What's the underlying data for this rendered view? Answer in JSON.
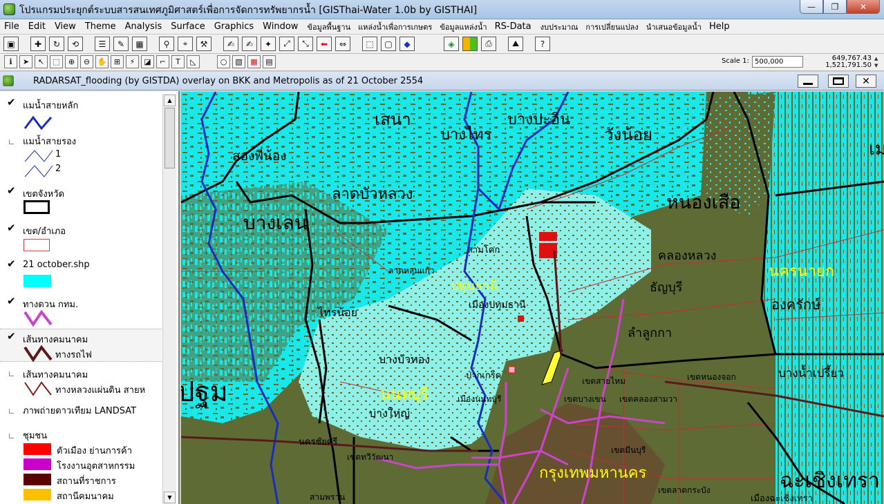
{
  "window": {
    "title": "โปรแกรมประยุกต์ระบบสารสนเทศภูมิศาสตร์เพื่อการจัดการทรัพยากรน้ำ  [GISThai-Water 1.0b   by GISTHAI]",
    "minimize": "—",
    "restore": "❐",
    "close": "✕"
  },
  "menu": [
    {
      "label": "File",
      "th": false
    },
    {
      "label": "Edit",
      "th": false
    },
    {
      "label": "View",
      "th": false
    },
    {
      "label": "Theme",
      "th": false
    },
    {
      "label": "Analysis",
      "th": false
    },
    {
      "label": "Surface",
      "th": false
    },
    {
      "label": "Graphics",
      "th": false
    },
    {
      "label": "Window",
      "th": false
    },
    {
      "label": "ข้อมูลพื้นฐาน",
      "th": true
    },
    {
      "label": "แหล่งน้ำเพื่อการเกษตร",
      "th": true
    },
    {
      "label": "ข้อมูลแหล่งน้ำ",
      "th": true
    },
    {
      "label": "RS-Data",
      "th": false
    },
    {
      "label": "งบประมาณ",
      "th": true
    },
    {
      "label": "การเปลี่ยนแปลง",
      "th": true
    },
    {
      "label": "นำเสนอข้อมูลน้ำ",
      "th": true
    },
    {
      "label": "Help",
      "th": false
    }
  ],
  "toolbar": {
    "scale_label": "Scale 1:",
    "scale_value": "500,000",
    "coord_x": "649,767.43",
    "coord_y": "1,521,791.50",
    "coord_arrows": "▲ ▼"
  },
  "document": {
    "title": "RADARSAT_flooding (by GISTDA) overlay on BKK and Metropolis as of 21 October 2554"
  },
  "legend": {
    "layers": [
      {
        "name": "แมน้ำสายหลัก",
        "checked": true
      },
      {
        "name": "แมน้ำสายรอง",
        "checked": false,
        "sub": [
          "1",
          "2"
        ]
      },
      {
        "name": "เขตจังหวัด",
        "checked": true
      },
      {
        "name": "เขต/อำเภอ",
        "checked": true
      },
      {
        "name": "21 october.shp",
        "checked": true
      },
      {
        "name": "ทางดวน กทม.",
        "checked": true
      },
      {
        "name": "เส้นทางคมนาคม",
        "checked": true,
        "sub_label": "ทางรถไฟ"
      },
      {
        "name": "เส้นทางคมนาคม",
        "checked": false,
        "sub_label": "ทางหลวงแผ่นดิน สายห"
      },
      {
        "name": "ภาพถ่ายดาวเทียม LANDSAT",
        "checked": false
      },
      {
        "name": "ชุมชน",
        "checked": false,
        "items": [
          {
            "label": "ตัวเมือง ย่านการค้า",
            "color": "#ff0000"
          },
          {
            "label": "โรงงานอุตสาหกรรม",
            "color": "#cc00cc"
          },
          {
            "label": "สถานที่ราชการ",
            "color": "#5a0000"
          },
          {
            "label": "สถานีคมนาคม",
            "color": "#ffc000"
          }
        ]
      }
    ],
    "colors": {
      "main_river": "#1a2cbf",
      "province_border": "#000000",
      "district_border": "#e03a3a",
      "flood": "#00ffff",
      "expressway": "#cc44cc",
      "railway": "#5a1a1a",
      "highway": "#8a1a1a"
    }
  },
  "map": {
    "colors": {
      "land": "#5e6b35",
      "flood": "#19e8ea",
      "urban_flood": "#8ff0e8",
      "bkk_urban": "#7d2d2d"
    },
    "labels": [
      {
        "text": "เสนา",
        "color": "#000"
      },
      {
        "text": "บางไทร",
        "color": "#000"
      },
      {
        "text": "บางปะอิน",
        "color": "#000"
      },
      {
        "text": "วังน้อย",
        "color": "#000"
      },
      {
        "text": "สองพี่น้อง",
        "color": "#000"
      },
      {
        "text": "ลาดบัวหลวง",
        "color": "#000"
      },
      {
        "text": "บางเลน",
        "color": "#000"
      },
      {
        "text": "หนองเสือ",
        "color": "#000"
      },
      {
        "text": "คลองหลวง",
        "color": "#000"
      },
      {
        "text": "ธัญบุรี",
        "color": "#000"
      },
      {
        "text": "ลำลูกกา",
        "color": "#000"
      },
      {
        "text": "ปทุมธานี",
        "color": "#ffff00"
      },
      {
        "text": "นครนายก",
        "color": "#ffff00"
      },
      {
        "text": "องครักษ์",
        "color": "#000"
      },
      {
        "text": "ไทรน้อย",
        "color": "#000"
      },
      {
        "text": "บางบัวทอง",
        "color": "#000"
      },
      {
        "text": "นนทบุรี",
        "color": "#ffff00"
      },
      {
        "text": "บางใหญ่",
        "color": "#000"
      },
      {
        "text": "ปฐม",
        "color": "#000"
      },
      {
        "text": "บางน้ำเปรี้ยว",
        "color": "#000"
      },
      {
        "text": "กรุงเทพมหานคร",
        "color": "#ffff00"
      },
      {
        "text": "ฉะเชิงเทรา",
        "color": "#000"
      },
      {
        "text": "เมืองปทุมธานี",
        "color": "#000"
      },
      {
        "text": "สามโคก",
        "color": "#000"
      },
      {
        "text": "ลาดหลุมแก้ว",
        "color": "#000"
      },
      {
        "text": "ปากเกร็ด",
        "color": "#000"
      },
      {
        "text": "เขตสายไหม",
        "color": "#000"
      },
      {
        "text": "เขตหนองจอก",
        "color": "#000"
      },
      {
        "text": "เขตคลองสามวา",
        "color": "#000"
      },
      {
        "text": "เขตบางเขน",
        "color": "#000"
      },
      {
        "text": "เขตมีนบุรี",
        "color": "#000"
      },
      {
        "text": "เขตลาดกระบัง",
        "color": "#000"
      },
      {
        "text": "เขตทวีวัฒนา",
        "color": "#000"
      },
      {
        "text": "สามพราน",
        "color": "#000"
      },
      {
        "text": "เมืองฉะเชิงเทรา",
        "color": "#000"
      },
      {
        "text": "นครชัยศรี",
        "color": "#000"
      },
      {
        "text": "เมืองนนทบุรี",
        "color": "#000"
      },
      {
        "text": "เม",
        "color": "#000"
      }
    ]
  }
}
